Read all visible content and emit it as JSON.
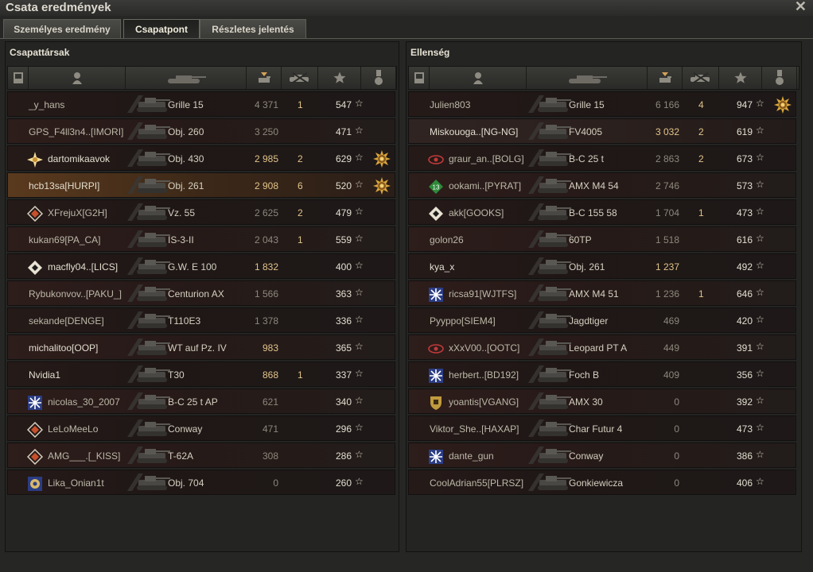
{
  "window": {
    "title": "Csata eredmények"
  },
  "tabs": [
    {
      "label": "Személyes eredmény",
      "active": false
    },
    {
      "label": "Csapatpont",
      "active": true
    },
    {
      "label": "Részletes jelentés",
      "active": false
    }
  ],
  "colors": {
    "gold": "#e2c48a",
    "gray": "#8d887c",
    "row_red": "#2d1d1b",
    "self_row": "#5a3a1e"
  },
  "header_icons": [
    "squad-icon",
    "player-icon",
    "tank-icon",
    "damage-icon",
    "kills-icon",
    "xp-star-icon",
    "medal-icon"
  ],
  "allies": {
    "title": "Csapattársak",
    "rows": [
      {
        "name": "_y_hans",
        "badge": null,
        "tank": "Grille 15",
        "damage": "4 371",
        "dmg_gold": false,
        "kills": "1",
        "xp": "547",
        "medal": false,
        "style": "alt",
        "name_white": false
      },
      {
        "name": "GPS_F4ll3n4..[IMORI]",
        "badge": null,
        "tank": "Obj. 260",
        "damage": "3 250",
        "dmg_gold": false,
        "kills": "",
        "xp": "471",
        "medal": false,
        "style": "",
        "name_white": false
      },
      {
        "name": "dartomikaavok",
        "badge": "starburst",
        "tank": "Obj. 430",
        "damage": "2 985",
        "dmg_gold": true,
        "kills": "2",
        "xp": "629",
        "medal": true,
        "style": "alt",
        "name_white": true
      },
      {
        "name": "hcb13sa[HURPI]",
        "badge": null,
        "tank": "Obj. 261",
        "damage": "2 908",
        "dmg_gold": true,
        "kills": "6",
        "xp": "520",
        "medal": true,
        "style": "self",
        "name_white": true
      },
      {
        "name": "XFrejuX[G2H]",
        "badge": "diamond",
        "tank": "Vz. 55",
        "damage": "2 625",
        "dmg_gold": false,
        "kills": "2",
        "xp": "479",
        "medal": false,
        "style": "alt",
        "name_white": false
      },
      {
        "name": "kukan69[PA_CA]",
        "badge": null,
        "tank": "IS-3-II",
        "damage": "2 043",
        "dmg_gold": false,
        "kills": "1",
        "xp": "559",
        "medal": false,
        "style": "",
        "name_white": false
      },
      {
        "name": "macfly04..[LICS]",
        "badge": "diamond-w",
        "tank": "G.W. E 100",
        "damage": "1 832",
        "dmg_gold": true,
        "kills": "",
        "xp": "400",
        "medal": false,
        "style": "alt",
        "name_white": true
      },
      {
        "name": "Rybukonvov..[PAKU_]",
        "badge": null,
        "tank": "Centurion AX",
        "damage": "1 566",
        "dmg_gold": false,
        "kills": "",
        "xp": "363",
        "medal": false,
        "style": "",
        "name_white": false
      },
      {
        "name": "sekande[DENGE]",
        "badge": null,
        "tank": "T110E3",
        "damage": "1 378",
        "dmg_gold": false,
        "kills": "",
        "xp": "336",
        "medal": false,
        "style": "alt",
        "name_white": false
      },
      {
        "name": "michalitoo[OOP]",
        "badge": null,
        "tank": "WT auf Pz. IV",
        "damage": "983",
        "dmg_gold": true,
        "kills": "",
        "xp": "365",
        "medal": false,
        "style": "",
        "name_white": true
      },
      {
        "name": "Nvidia1",
        "badge": null,
        "tank": "T30",
        "damage": "868",
        "dmg_gold": true,
        "kills": "1",
        "xp": "337",
        "medal": false,
        "style": "alt",
        "name_white": true
      },
      {
        "name": "nicolas_30_2007",
        "badge": "snowflake",
        "tank": "B-C 25 t AP",
        "damage": "621",
        "dmg_gold": false,
        "kills": "",
        "xp": "340",
        "medal": false,
        "style": "",
        "name_white": false
      },
      {
        "name": "LeLoMeeLo",
        "badge": "diamond",
        "tank": "Conway",
        "damage": "471",
        "dmg_gold": false,
        "kills": "",
        "xp": "296",
        "medal": false,
        "style": "alt",
        "name_white": false
      },
      {
        "name": "AMG___.[_KISS]",
        "badge": "diamond",
        "tank": "T-62A",
        "damage": "308",
        "dmg_gold": false,
        "kills": "",
        "xp": "286",
        "medal": false,
        "style": "",
        "name_white": false
      },
      {
        "name": "Lika_Onian1t",
        "badge": "gear",
        "tank": "Obj. 704",
        "damage": "0",
        "dmg_gold": false,
        "kills": "",
        "xp": "260",
        "medal": false,
        "style": "alt",
        "name_white": false
      }
    ]
  },
  "enemies": {
    "title": "Ellenség",
    "rows": [
      {
        "name": "Julien803",
        "badge": null,
        "tank": "Grille 15",
        "damage": "6 166",
        "dmg_gold": false,
        "kills": "4",
        "xp": "947",
        "medal": true,
        "style": "alt",
        "name_white": false
      },
      {
        "name": "Miskouoga..[NG-NG]",
        "badge": null,
        "tank": "FV4005",
        "damage": "3 032",
        "dmg_gold": true,
        "kills": "2",
        "xp": "619",
        "medal": false,
        "style": "hl",
        "name_white": true
      },
      {
        "name": "graur_an..[BOLG]",
        "badge": "eye",
        "tank": "B-C 25 t",
        "damage": "2 863",
        "dmg_gold": false,
        "kills": "2",
        "xp": "673",
        "medal": false,
        "style": "alt",
        "name_white": false
      },
      {
        "name": "ookami..[PYRAT]",
        "badge": "green13",
        "tank": "AMX M4 54",
        "damage": "2 746",
        "dmg_gold": false,
        "kills": "",
        "xp": "573",
        "medal": false,
        "style": "",
        "name_white": false
      },
      {
        "name": "akk[GOOKS]",
        "badge": "diamond-w",
        "tank": "B-C 155 58",
        "damage": "1 704",
        "dmg_gold": false,
        "kills": "1",
        "xp": "473",
        "medal": false,
        "style": "alt",
        "name_white": false
      },
      {
        "name": "golon26",
        "badge": null,
        "tank": "60TP",
        "damage": "1 518",
        "dmg_gold": false,
        "kills": "",
        "xp": "616",
        "medal": false,
        "style": "",
        "name_white": false
      },
      {
        "name": "kya_x",
        "badge": null,
        "tank": "Obj. 261",
        "damage": "1 237",
        "dmg_gold": true,
        "kills": "",
        "xp": "492",
        "medal": false,
        "style": "alt",
        "name_white": true
      },
      {
        "name": "ricsa91[WJTFS]",
        "badge": "snowflake",
        "tank": "AMX M4 51",
        "damage": "1 236",
        "dmg_gold": false,
        "kills": "1",
        "xp": "646",
        "medal": false,
        "style": "",
        "name_white": false
      },
      {
        "name": "Pyyppo[SIEM4]",
        "badge": null,
        "tank": "Jagdtiger",
        "damage": "469",
        "dmg_gold": false,
        "kills": "",
        "xp": "420",
        "medal": false,
        "style": "alt",
        "name_white": false
      },
      {
        "name": "xXxV00..[OOTC]",
        "badge": "eye",
        "tank": "Leopard PT A",
        "damage": "449",
        "dmg_gold": false,
        "kills": "",
        "xp": "391",
        "medal": false,
        "style": "",
        "name_white": false
      },
      {
        "name": "herbert..[BD192]",
        "badge": "snowflake",
        "tank": "Foch B",
        "damage": "409",
        "dmg_gold": false,
        "kills": "",
        "xp": "356",
        "medal": false,
        "style": "alt",
        "name_white": false
      },
      {
        "name": "yoantis[VGANG]",
        "badge": "shield",
        "tank": "AMX 30",
        "damage": "0",
        "dmg_gold": false,
        "kills": "",
        "xp": "392",
        "medal": false,
        "style": "",
        "name_white": false
      },
      {
        "name": "Viktor_She..[HAXAP]",
        "badge": null,
        "tank": "Char Futur 4",
        "damage": "0",
        "dmg_gold": false,
        "kills": "",
        "xp": "473",
        "medal": false,
        "style": "alt",
        "name_white": false
      },
      {
        "name": "dante_gun",
        "badge": "snowflake",
        "tank": "Conway",
        "damage": "0",
        "dmg_gold": false,
        "kills": "",
        "xp": "386",
        "medal": false,
        "style": "",
        "name_white": false
      },
      {
        "name": "CoolAdrian55[PLRSZ]",
        "badge": null,
        "tank": "Gonkiewicza",
        "damage": "0",
        "dmg_gold": false,
        "kills": "",
        "xp": "406",
        "medal": false,
        "style": "alt",
        "name_white": false
      }
    ]
  }
}
